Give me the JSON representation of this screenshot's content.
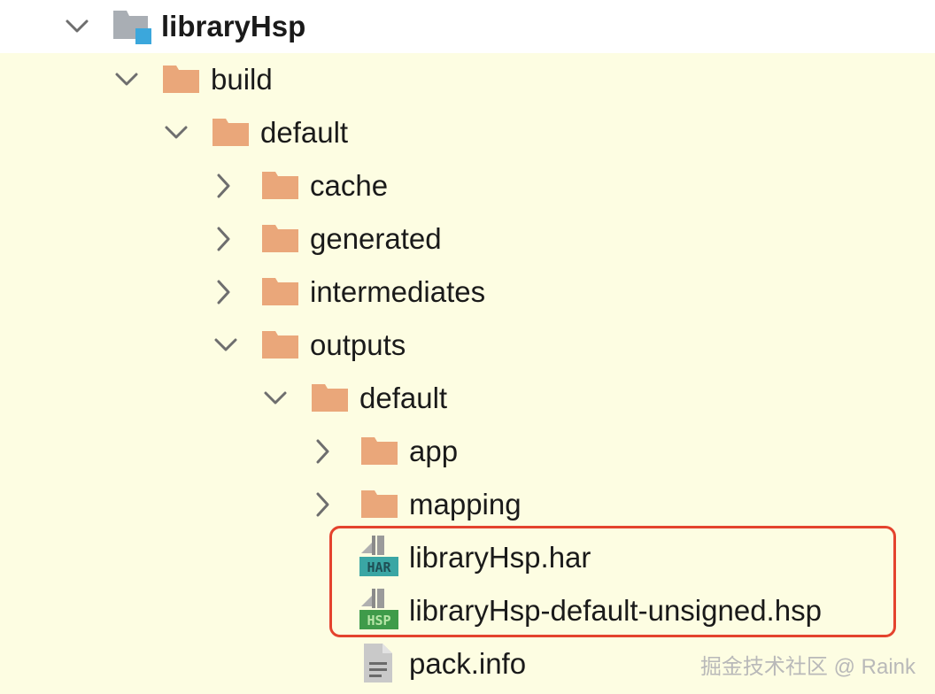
{
  "tree": {
    "root": {
      "label": "libraryHsp"
    },
    "build": {
      "label": "build"
    },
    "default": {
      "label": "default"
    },
    "cache": {
      "label": "cache"
    },
    "generated": {
      "label": "generated"
    },
    "intermediates": {
      "label": "intermediates"
    },
    "outputs": {
      "label": "outputs"
    },
    "outputs_default": {
      "label": "default"
    },
    "app": {
      "label": "app"
    },
    "mapping": {
      "label": "mapping"
    },
    "har_file": {
      "label": "libraryHsp.har",
      "badge": "HAR"
    },
    "hsp_file": {
      "label": "libraryHsp-default-unsigned.hsp",
      "badge": "HSP"
    },
    "pack_info": {
      "label": "pack.info"
    }
  },
  "colors": {
    "folder": "#eaa77a",
    "highlight_border": "#e4432e",
    "row_background": "#fdfde2",
    "har_badge": "#3aa6a4",
    "hsp_badge": "#3f9b4a"
  },
  "watermark": "掘金技术社区 @ Raink"
}
